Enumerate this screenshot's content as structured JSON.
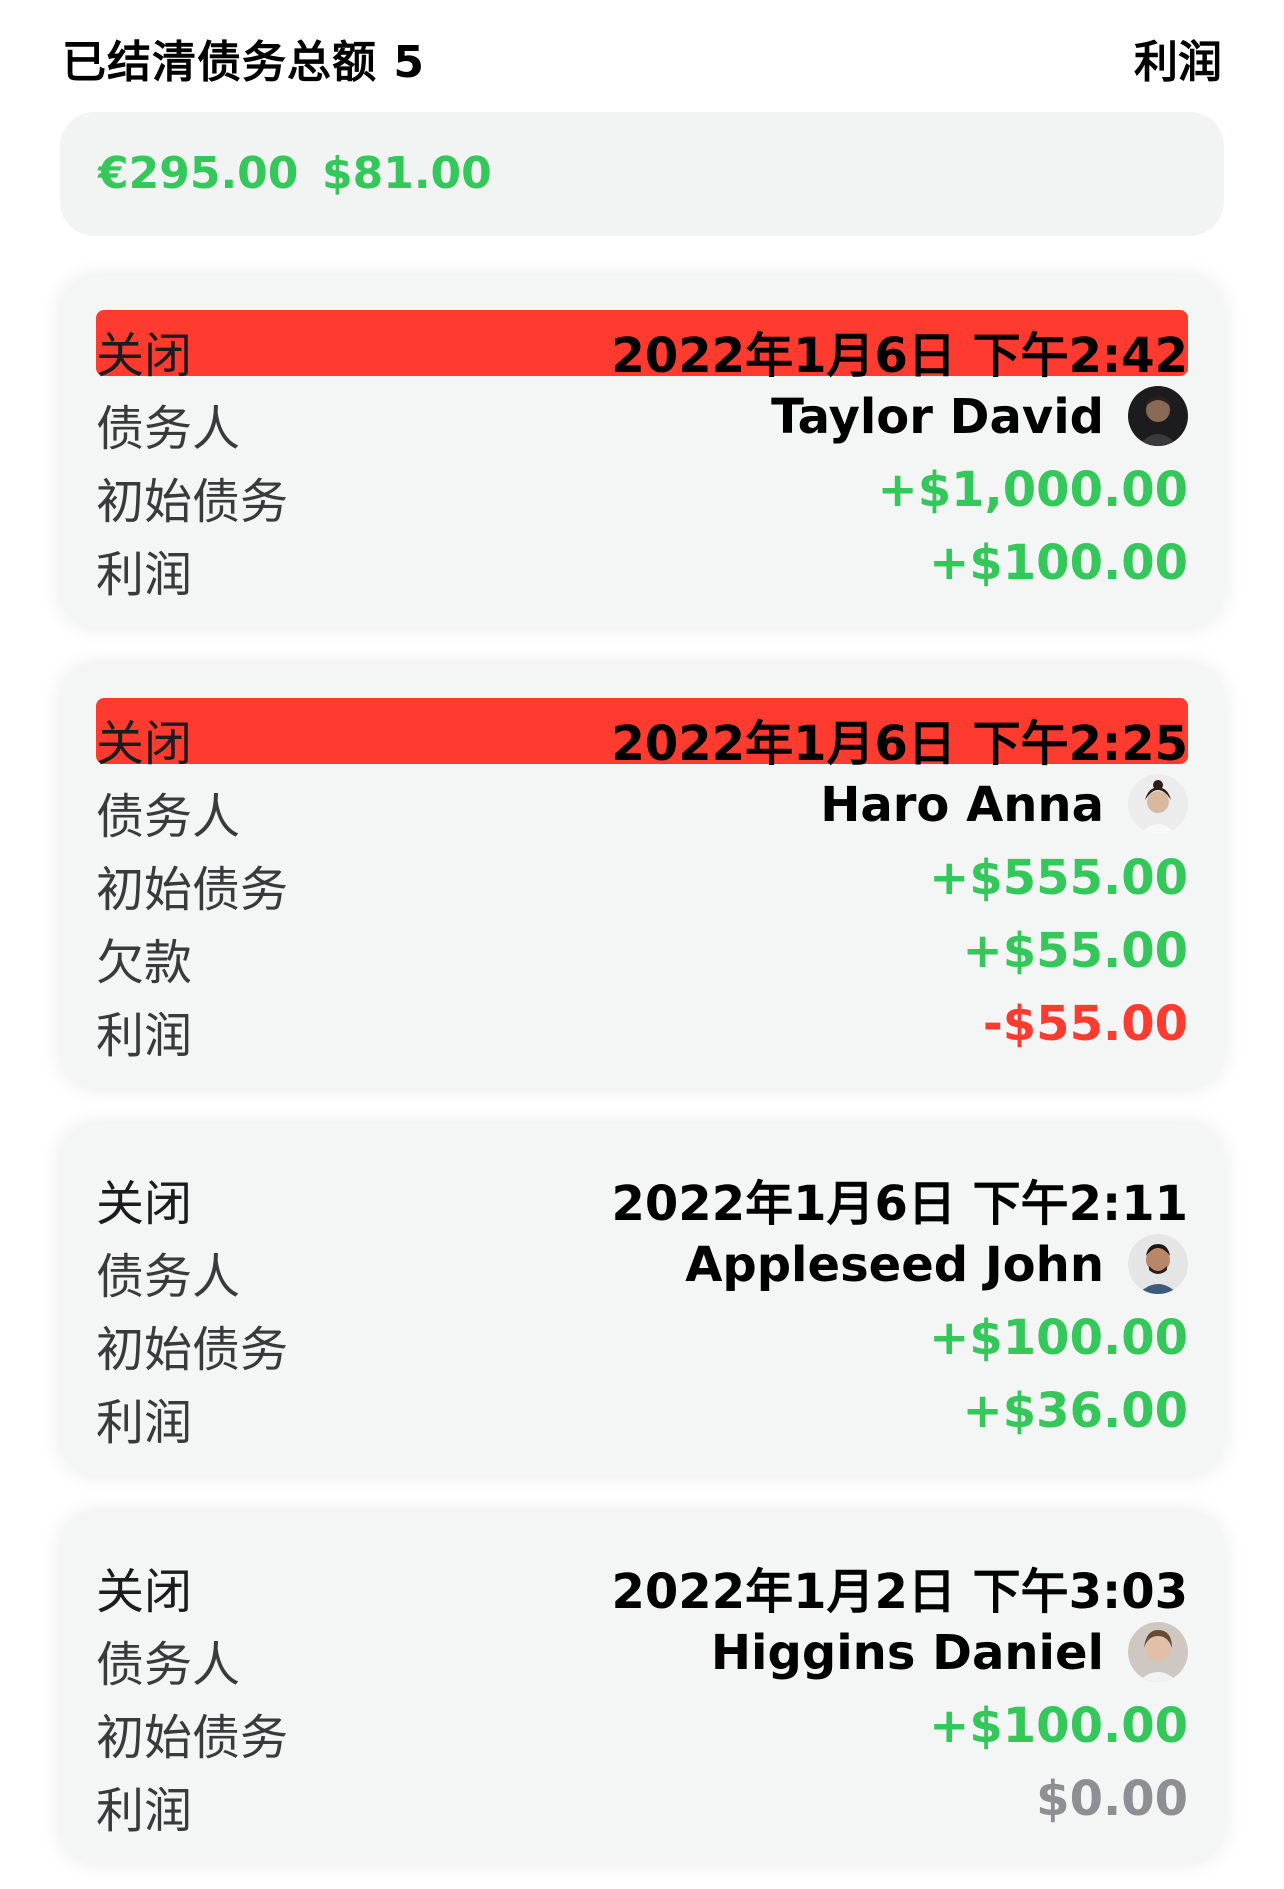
{
  "header": {
    "title": "已结清债务总额 5",
    "profit_link": "利润"
  },
  "totals": [
    "€295.00",
    "$81.00"
  ],
  "labels": {
    "closed": "关闭",
    "debtor": "债务人",
    "initial_debt": "初始债务",
    "owed": "欠款",
    "profit": "利润"
  },
  "cards": [
    {
      "closed_date": "2022年1月6日 下午2:42",
      "date_highlight": true,
      "debtor": "Taylor David",
      "avatar": "avatar-photo",
      "initial_debt": "+$1,000.00",
      "profit": "+$100.00",
      "profit_color": "#34c759"
    },
    {
      "closed_date": "2022年1月6日 下午2:25",
      "date_highlight": true,
      "debtor": "Haro Anna",
      "avatar": "avatar-photo",
      "initial_debt": "+$555.00",
      "owed": "+$55.00",
      "profit": "-$55.00",
      "profit_color": "#ff3b30"
    },
    {
      "closed_date": "2022年1月6日 下午2:11",
      "date_highlight": false,
      "debtor": "Appleseed John",
      "avatar": "avatar-photo",
      "initial_debt": "+$100.00",
      "profit": "+$36.00",
      "profit_color": "#34c759"
    },
    {
      "closed_date": "2022年1月2日 下午3:03",
      "date_highlight": false,
      "debtor": "Higgins Daniel",
      "avatar": "avatar-photo",
      "initial_debt": "+$100.00",
      "profit": "$0.00",
      "profit_color": "#8e8e93"
    }
  ],
  "colors": {
    "accent_green": "#34c759",
    "accent_red": "#ff3b30",
    "neutral_gray": "#8e8e93",
    "card_bg": "#f4f5f5"
  }
}
